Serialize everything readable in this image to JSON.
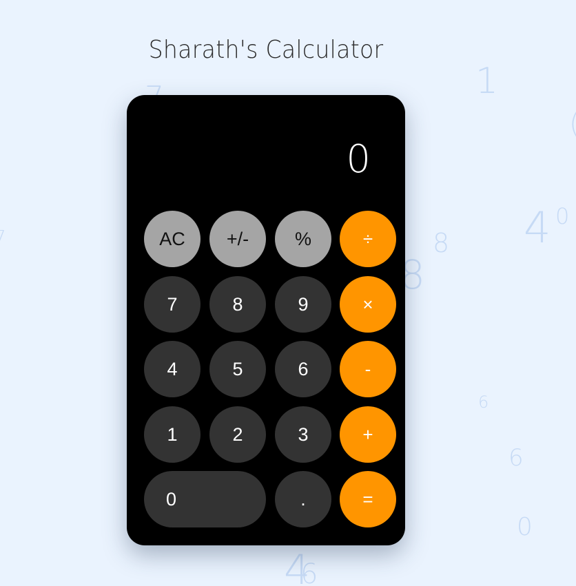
{
  "title": "Sharath's Calculator",
  "display": {
    "value": "0"
  },
  "background_digits": [
    "7",
    "1",
    "7",
    "4",
    "0",
    "8",
    "8",
    "6",
    "6",
    "0",
    "4",
    "6"
  ],
  "buttons": {
    "clear": "AC",
    "sign": "+/-",
    "percent": "%",
    "divide": "÷",
    "seven": "7",
    "eight": "8",
    "nine": "9",
    "multiply": "×",
    "four": "4",
    "five": "5",
    "six": "6",
    "subtract": "-",
    "one": "1",
    "two": "2",
    "three": "3",
    "add": "+",
    "zero": "0",
    "decimal": ".",
    "equals": "="
  },
  "colors": {
    "background": "#eaf3fe",
    "calculator_body": "#000000",
    "function_key": "#a5a5a5",
    "number_key": "#333333",
    "operator_key": "#ff9500"
  }
}
